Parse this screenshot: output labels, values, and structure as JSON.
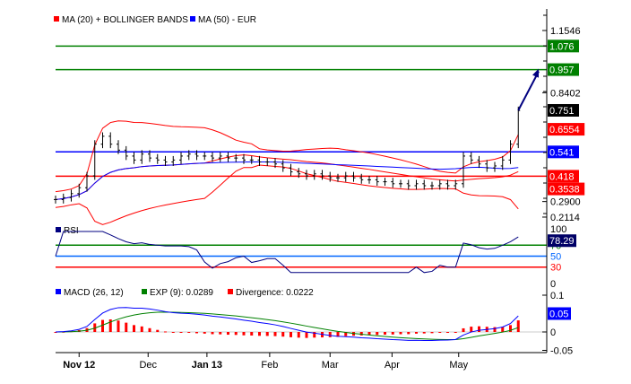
{
  "chart_data": {
    "type": "line",
    "title": "EUR",
    "legend": [
      {
        "label": "MA (20) + BOLLINGER BANDS",
        "color": "#ff0000"
      },
      {
        "label": "MA (50) - EUR",
        "color": "#0000ff"
      }
    ],
    "price_axis_ticks": [
      "1.1546",
      "0.8402",
      "0.2900",
      "0.2114"
    ],
    "price_ylim": [
      0.2114,
      1.1546
    ],
    "closes": [
      0.3,
      0.31,
      0.33,
      0.36,
      0.42,
      0.58,
      0.62,
      0.58,
      0.55,
      0.52,
      0.5,
      0.53,
      0.51,
      0.5,
      0.49,
      0.5,
      0.52,
      0.53,
      0.52,
      0.52,
      0.51,
      0.52,
      0.51,
      0.51,
      0.5,
      0.5,
      0.49,
      0.49,
      0.48,
      0.46,
      0.44,
      0.43,
      0.42,
      0.43,
      0.42,
      0.41,
      0.41,
      0.42,
      0.41,
      0.4,
      0.4,
      0.39,
      0.39,
      0.38,
      0.38,
      0.37,
      0.38,
      0.37,
      0.37,
      0.38,
      0.37,
      0.38,
      0.52,
      0.5,
      0.48,
      0.46,
      0.47,
      0.5,
      0.58,
      0.75
    ],
    "levels": [
      {
        "value": 1.076,
        "label": "1.076",
        "color": "#008000",
        "line": true
      },
      {
        "value": 0.957,
        "label": "0.957",
        "color": "#008000",
        "line": true
      },
      {
        "value": 0.751,
        "label": "0.751",
        "color": "#000000",
        "line": false
      },
      {
        "value": 0.6554,
        "label": "0.6554",
        "color": "#ff0000",
        "line": false
      },
      {
        "value": 0.541,
        "label": "0.541",
        "color": "#0000ff",
        "line": true
      },
      {
        "value": 0.418,
        "label": "0.418",
        "color": "#ff0000",
        "line": true
      },
      {
        "value": 0.3538,
        "label": "0.3538",
        "color": "#ff0000",
        "line": false
      }
    ],
    "trend_arrow": {
      "from": 0.751,
      "to": 0.957
    },
    "x_labels": [
      {
        "label": "Nov 12",
        "index": 3
      },
      {
        "label": "Dec",
        "index": 11.8
      },
      {
        "label": "Jan 13",
        "index": 19.3
      },
      {
        "label": "Feb",
        "index": 27.3
      },
      {
        "label": "Mar",
        "index": 35
      },
      {
        "label": "Apr",
        "index": 42.9
      },
      {
        "label": "May",
        "index": 51.4
      }
    ],
    "rsi": {
      "title": "RSI",
      "value": "78.29",
      "ticks": [
        "100",
        "0"
      ],
      "levels": [
        {
          "value": 70,
          "label": "70",
          "color": "#008000"
        },
        {
          "value": 50,
          "label": "50",
          "color": "#0066ff"
        },
        {
          "value": 30,
          "label": "30",
          "color": "#ff0000"
        }
      ]
    },
    "macd": {
      "legend": [
        {
          "label": "MACD (26, 12)",
          "color": "#0000ff"
        },
        {
          "label": "EXP (9): 0.0289",
          "color": "#008000"
        },
        {
          "label": "Divergence: 0.0222",
          "color": "#ff0000"
        }
      ],
      "value": "0.05",
      "ticks": [
        "0.1",
        "0",
        "-0.05"
      ],
      "ylim": [
        -0.05,
        0.1
      ]
    }
  }
}
